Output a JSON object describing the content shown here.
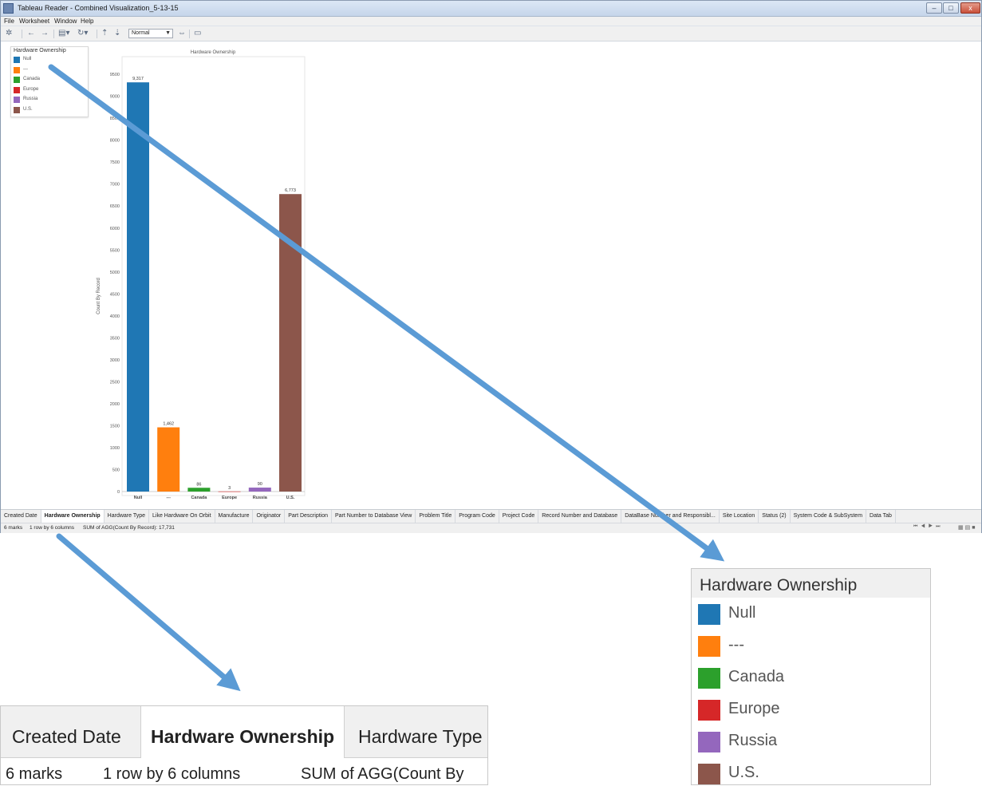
{
  "window": {
    "title": "Tableau Reader - Combined Visualization_5-13-15",
    "controls": [
      "–",
      "□",
      "x"
    ]
  },
  "menu": [
    "File",
    "Worksheet",
    "Window",
    "Help"
  ],
  "toolbar": {
    "view_select": "Normal"
  },
  "legend": {
    "title": "Hardware Ownership",
    "items": [
      {
        "label": "Null",
        "color": "#1f77b4"
      },
      {
        "label": "---",
        "color": "#ff7f0e"
      },
      {
        "label": "Canada",
        "color": "#2ca02c"
      },
      {
        "label": "Europe",
        "color": "#d62728"
      },
      {
        "label": "Russia",
        "color": "#9467bd"
      },
      {
        "label": "U.S.",
        "color": "#8c564b"
      }
    ]
  },
  "chart_data": {
    "type": "bar",
    "title": "Hardware Ownership",
    "ylabel": "Count By Record",
    "xlabel": "",
    "categories": [
      "Null",
      "---",
      "Canada",
      "Europe",
      "Russia",
      "U.S."
    ],
    "values": [
      9317,
      1462,
      86,
      3,
      90,
      6773
    ],
    "data_labels": [
      "9,317",
      "1,462",
      "86",
      "3",
      "90",
      "6,773"
    ],
    "colors": [
      "#1f77b4",
      "#ff7f0e",
      "#2ca02c",
      "#d62728",
      "#9467bd",
      "#8c564b"
    ],
    "ylim": [
      0,
      10000
    ],
    "yticks": [
      0,
      500,
      1000,
      1500,
      2000,
      2500,
      3000,
      3500,
      4000,
      4500,
      5000,
      5500,
      6000,
      6500,
      7000,
      7500,
      8000,
      8500,
      9000,
      9500
    ],
    "grid": false
  },
  "tabs": [
    {
      "label": "Created Date",
      "active": false
    },
    {
      "label": "Hardware Ownership",
      "active": true
    },
    {
      "label": "Hardware Type",
      "active": false
    },
    {
      "label": "Like Hardware On Orbit",
      "active": false
    },
    {
      "label": "Manufacture",
      "active": false
    },
    {
      "label": "Originator",
      "active": false
    },
    {
      "label": "Part Description",
      "active": false
    },
    {
      "label": "Part Number to Database View",
      "active": false
    },
    {
      "label": "Problem Title",
      "active": false
    },
    {
      "label": "Program Code",
      "active": false
    },
    {
      "label": "Project Code",
      "active": false
    },
    {
      "label": "Record Number and Database",
      "active": false
    },
    {
      "label": "DataBase Number and Responsibl...",
      "active": false
    },
    {
      "label": "Site Location",
      "active": false
    },
    {
      "label": "Status (2)",
      "active": false
    },
    {
      "label": "System Code & SubSystem",
      "active": false
    },
    {
      "label": "Data Tab",
      "active": false
    }
  ],
  "status": {
    "marks": "6 marks",
    "rows": "1 row by 6 columns",
    "sum": "SUM of AGG(Count By Record): 17,731"
  },
  "zoom_tabs": {
    "tabs": [
      "Created Date",
      "Hardware Ownership",
      "Hardware Type"
    ],
    "status_marks": "6 marks",
    "status_rows": "1 row by 6 columns",
    "status_sum": "SUM of AGG(Count By"
  },
  "arrow_color": "#5b9bd5"
}
